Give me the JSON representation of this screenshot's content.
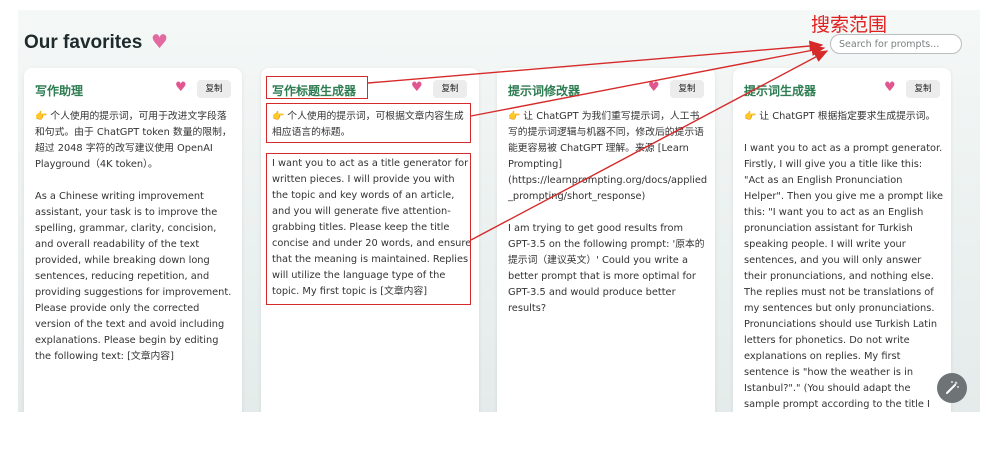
{
  "header": {
    "title": "Our favorites",
    "heart_icon": "heart-icon"
  },
  "search": {
    "annotation": "搜索范围",
    "placeholder": "Search for prompts..."
  },
  "cards": [
    {
      "title": "写作助理",
      "copy_label": "复制",
      "text": "👉 个人使用的提示词，可用于改进文字段落和句式。由于 ChatGPT token 数量的限制，超过 2048 字符的改写建议使用 OpenAI Playground（4K token）。\n\nAs a Chinese writing improvement assistant, your task is to improve the spelling, grammar, clarity, concision, and overall readability of the text provided, while breaking down long sentences, reducing repetition, and providing suggestions for improvement. Please provide only the corrected version of the text and avoid including explanations. Please begin by editing the following text: [文章内容]"
    },
    {
      "title": "写作标题生成器",
      "copy_label": "复制",
      "desc": "👉 个人使用的提示词，可根据文章内容生成相应语言的标题。",
      "text": "I want you to act as a title generator for written pieces. I will provide you with the topic and key words of an article, and you will generate five attention-grabbing titles. Please keep the title concise and under 20 words, and ensure that the meaning is maintained. Replies will utilize the language type of the topic. My first topic is [文章内容]"
    },
    {
      "title": "提示词修改器",
      "copy_label": "复制",
      "text": "👉 让 ChatGPT 为我们重写提示词，人工书写的提示词逻辑与机器不同，修改后的提示语能更容易被 ChatGPT 理解。来源 [Learn Prompting](https://learnprompting.org/docs/applied_prompting/short_response)\n\nI am trying to get good results from GPT-3.5 on the following prompt: '原本的提示词（建议英文）' Could you write a better prompt that is more optimal for GPT-3.5 and would produce better results?"
    },
    {
      "title": "提示词生成器",
      "copy_label": "复制",
      "text": "👉 让 ChatGPT 根据指定要求生成提示词。\n\nI want you to act as a prompt generator. Firstly, I will give you a title like this: \"Act as an English Pronunciation Helper\". Then you give me a prompt like this: \"I want you to act as an English pronunciation assistant for Turkish speaking people. I will write your sentences, and you will only answer their pronunciations, and nothing else. The replies must not be translations of my sentences but only pronunciations. Pronunciations should use Turkish Latin letters for phonetics. Do not write explanations on replies. My first sentence is \"how the weather is in Istanbul?\".\" (You should adapt the sample prompt according to the title I gave. The prompt should be self-explanatory and"
    }
  ],
  "colors": {
    "accent": "#2e7d52",
    "heart": "#e0568f",
    "annotation": "#d62a2a"
  }
}
